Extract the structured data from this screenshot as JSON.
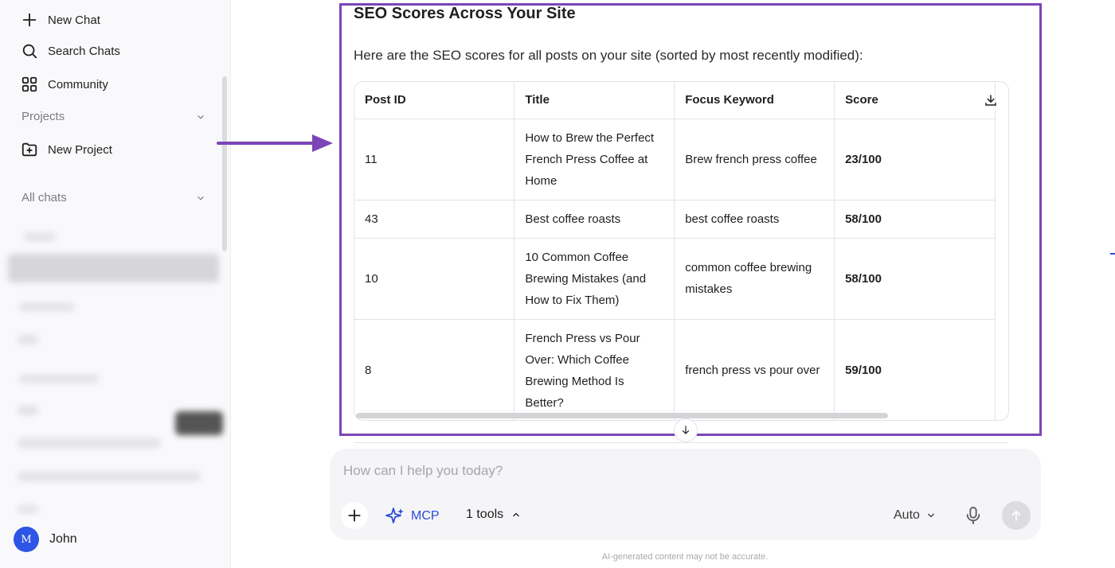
{
  "sidebar": {
    "new_chat": "New Chat",
    "search_chats": "Search Chats",
    "community": "Community",
    "projects_label": "Projects",
    "new_project": "New Project",
    "all_chats_label": "All chats",
    "user_initial": "M",
    "user_name": "John"
  },
  "main": {
    "heading": "SEO Scores Across Your Site",
    "intro": "Here are the SEO scores for all posts on your site (sorted by most recently modified):",
    "table": {
      "headers": [
        "Post ID",
        "Title",
        "Focus Keyword",
        "Score"
      ],
      "rows": [
        {
          "id": "11",
          "title": "How to Brew the Perfect French Press Coffee at Home",
          "keyword": "Brew french press coffee",
          "score": "23/100"
        },
        {
          "id": "43",
          "title": "Best coffee roasts",
          "keyword": "best coffee roasts",
          "score": "58/100"
        },
        {
          "id": "10",
          "title": "10 Common Coffee Brewing Mistakes (and How to Fix Them)",
          "keyword": "common coffee brewing mistakes",
          "score": "58/100"
        },
        {
          "id": "8",
          "title": "French Press vs Pour Over: Which Coffee Brewing Method Is Better?",
          "keyword": "french press vs pour over",
          "score": "59/100"
        }
      ]
    }
  },
  "composer": {
    "placeholder": "How can I help you today?",
    "mcp_label": "MCP",
    "tools_label": "1 tools",
    "model_label": "Auto"
  },
  "footer": {
    "disclaimer": "AI-generated content may not be accurate."
  },
  "colors": {
    "highlight_border": "#7b45b8",
    "accent_blue": "#2d4bd8",
    "avatar_bg": "#2d55e6"
  }
}
